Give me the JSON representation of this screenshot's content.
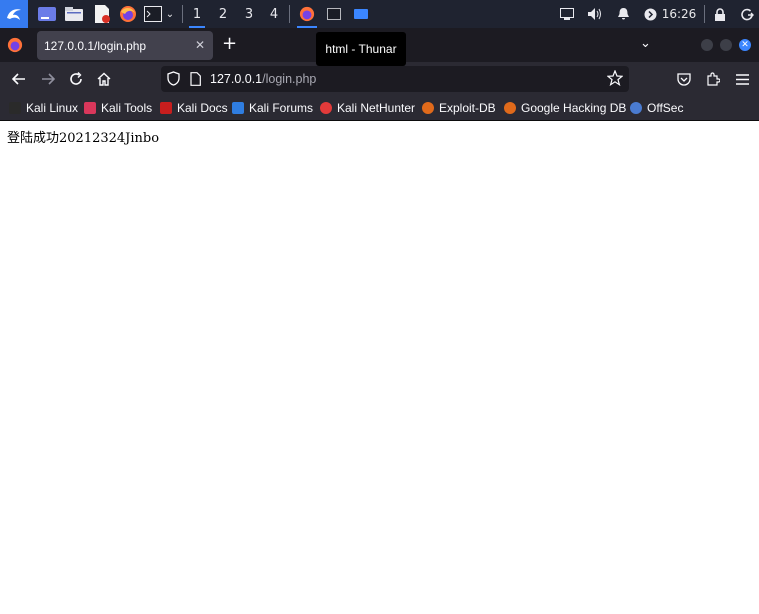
{
  "panel": {
    "workspaces": [
      "1",
      "2",
      "3",
      "4"
    ],
    "active_workspace": "1",
    "clock": "16:26",
    "icons": [
      "kali-menu-icon",
      "show-desktop-icon",
      "file-manager-icon",
      "text-editor-icon",
      "firefox-icon",
      "terminal-icon",
      "chevron-down-icon",
      "firefox-task-icon",
      "terminal-task-icon",
      "thunar-task-icon",
      "display-icon",
      "volume-icon",
      "notification-icon",
      "power-indicator-icon",
      "lock-icon",
      "logout-icon"
    ]
  },
  "browser": {
    "tab_title": "127.0.0.1/login.php",
    "new_tab_label": "+",
    "tooltip": "html - Thunar",
    "url_host": "127.0.0.1",
    "url_path": "/login.php"
  },
  "bookmarks": [
    {
      "label": "Kali Linux",
      "color": "#2a2a2a"
    },
    {
      "label": "Kali Tools",
      "color": "#d9375b"
    },
    {
      "label": "Kali Docs",
      "color": "#c81e1e"
    },
    {
      "label": "Kali Forums",
      "color": "#2f7de1"
    },
    {
      "label": "Kali NetHunter",
      "color": "#e23a3a"
    },
    {
      "label": "Exploit-DB",
      "color": "#e06a1b"
    },
    {
      "label": "Google Hacking DB",
      "color": "#e06a1b"
    },
    {
      "label": "OffSec",
      "color": "#4a7bd0"
    }
  ],
  "page": {
    "content": "登陆成功20212324Jinbo"
  },
  "colors": {
    "panel_bg": "#1f2330",
    "accent": "#3b86ff",
    "toolbar_bg": "#2b2a33",
    "tab_bg": "#42414d"
  }
}
